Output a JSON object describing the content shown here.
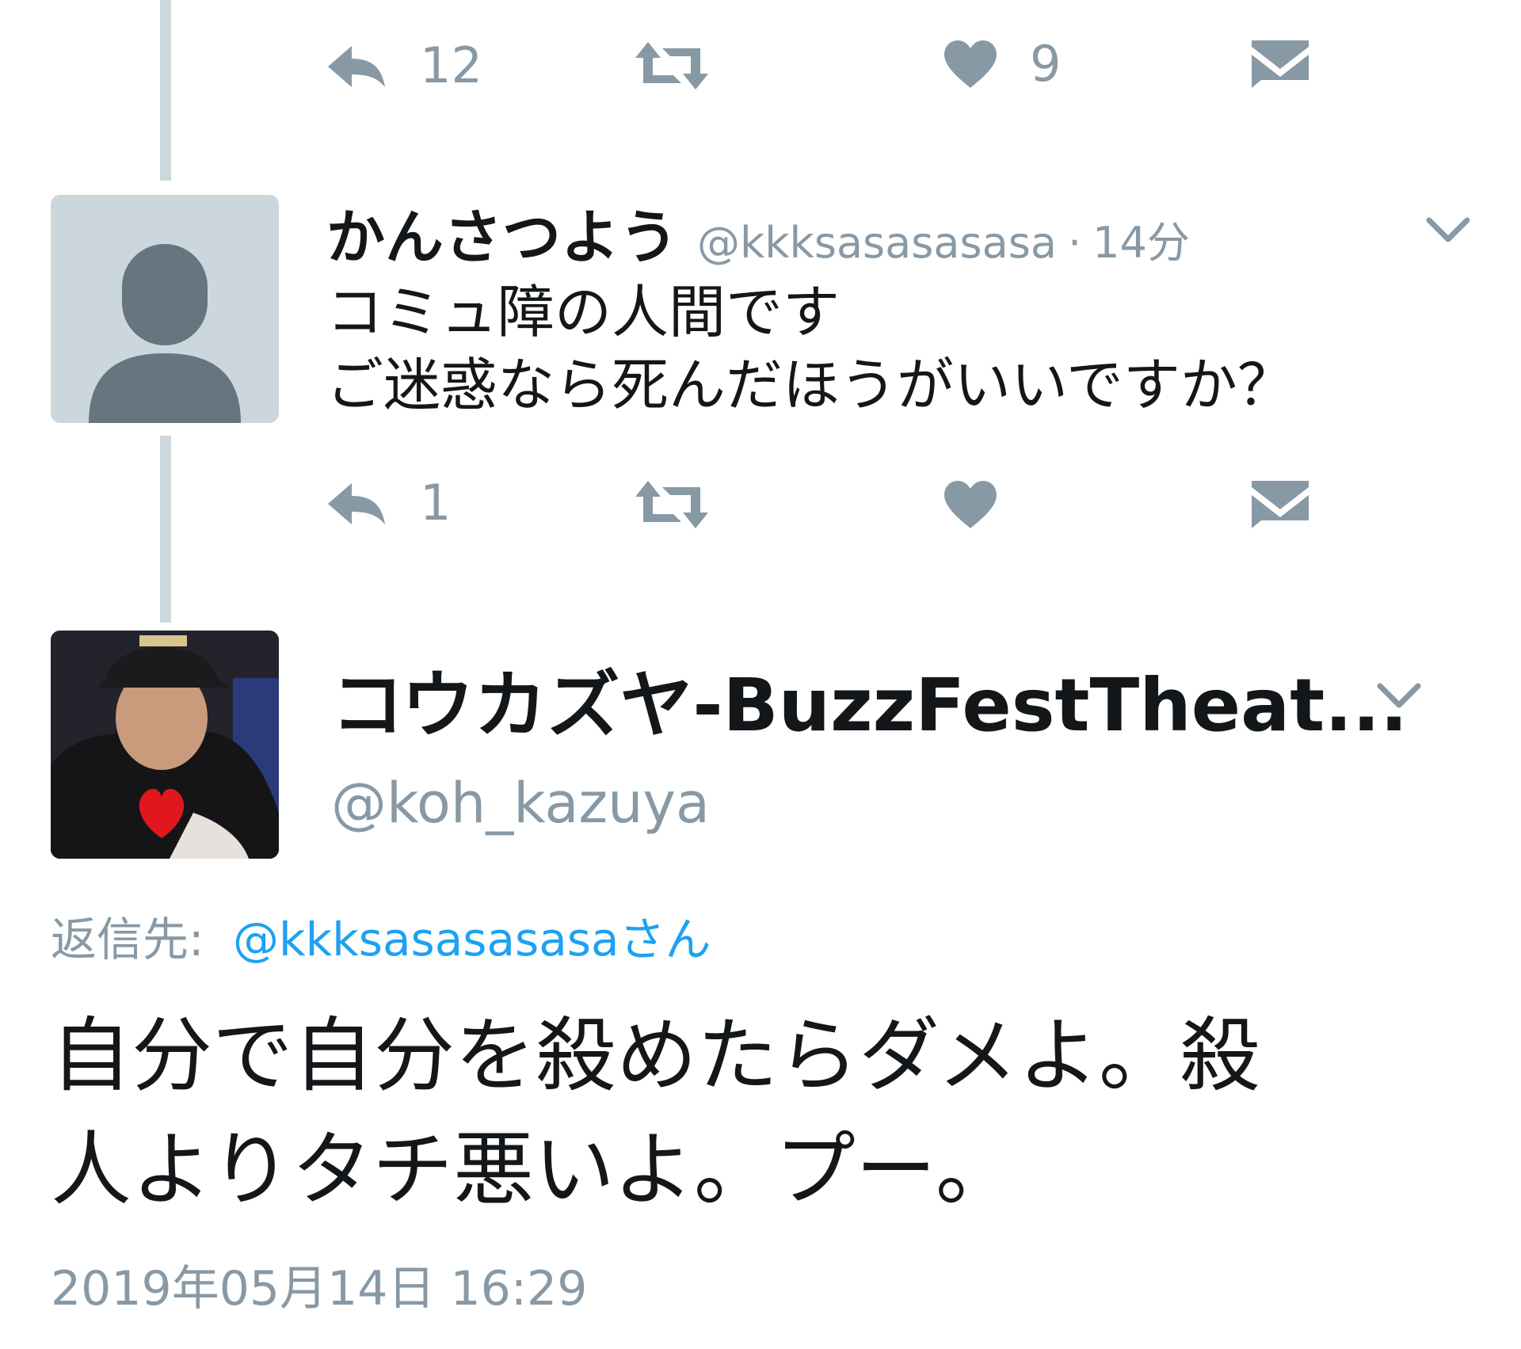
{
  "tweet1_actions": {
    "reply_count": "12",
    "like_count": "9",
    "reply_icon": "reply-icon",
    "retweet_icon": "retweet-icon",
    "like_icon": "heart-icon",
    "dm_icon": "envelope-icon"
  },
  "tweet2": {
    "display_name": "かんさつよう",
    "handle": "@kkksasasasasa",
    "separator": "·",
    "time_ago": "14分",
    "text_line1": "コミュ障の人間です",
    "text_line2": "ご迷惑なら死んだほうがいいですか？",
    "reply_count": "1"
  },
  "tweet3": {
    "display_name": "コウカズヤ-BuzzFestTheat...",
    "handle": "@koh_kazuya",
    "reply_to_label": "返信先:",
    "reply_to_handle": "@kkksasasasasaさん",
    "text_line1": "自分で自分を殺めたらダメよ。殺",
    "text_line2": "人よりタチ悪いよ。プー。",
    "timestamp": "2019年05月14日 16:29"
  },
  "colors": {
    "icon_gray": "#8899a6",
    "thread_line": "#ccd6dd",
    "link_blue": "#1da1f2",
    "text_dark": "#14171a"
  }
}
